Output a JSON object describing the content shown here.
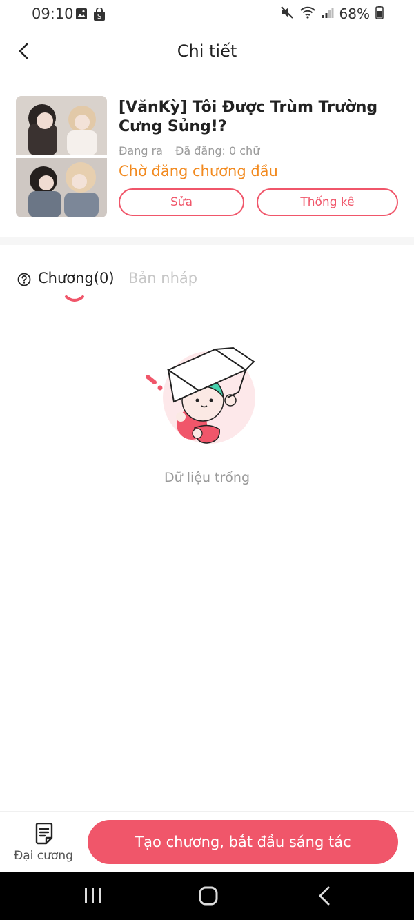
{
  "status_bar": {
    "time": "09:10",
    "battery": "68%",
    "icons_left": [
      "image-icon",
      "shopping-bag-icon"
    ],
    "icons_right": [
      "mute-icon",
      "wifi-icon",
      "signal-icon",
      "battery-icon"
    ]
  },
  "header": {
    "title": "Chi tiết"
  },
  "story": {
    "title": "[VănKỳ] Tôi Được Trùm Trường Cưng Sủng!?",
    "state": "Đang ra",
    "published": "Đã đăng: 0 chữ",
    "status_text": "Chờ đăng chương đầu",
    "edit_label": "Sửa",
    "stats_label": "Thống kê"
  },
  "tabs": {
    "chapters": "Chương(0)",
    "drafts": "Bản nháp"
  },
  "empty_state": {
    "text": "Dữ liệu trống"
  },
  "bottom_bar": {
    "outline_label": "Đại cương",
    "create_label": "Tạo chương, bắt đầu sáng tác"
  },
  "colors": {
    "accent": "#f0566a",
    "status_orange": "#f28a1f",
    "muted": "#999999"
  }
}
